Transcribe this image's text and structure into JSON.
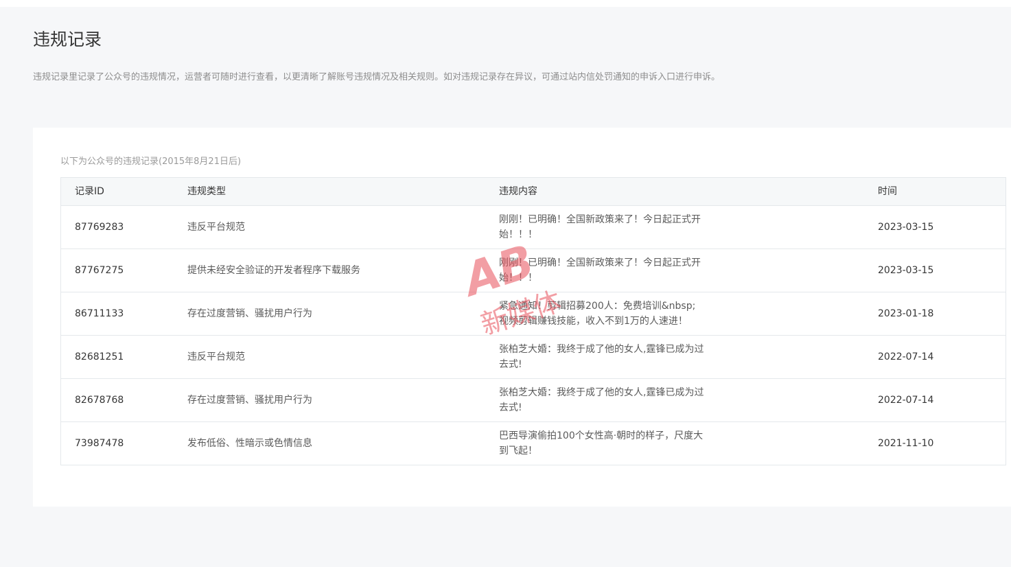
{
  "page": {
    "title": "违规记录",
    "description": "违规记录里记录了公众号的违规情况，运营者可随时进行查看，以更清晰了解账号违规情况及相关规则。如对违规记录存在异议，可通过站内信处罚通知的申诉入口进行申诉。"
  },
  "table": {
    "caption": "以下为公众号的违规记录(2015年8月21日后)",
    "headers": {
      "id": "记录ID",
      "type": "违规类型",
      "content": "违规内容",
      "time": "时间"
    },
    "rows": [
      {
        "id": "87769283",
        "type": "违反平台规范",
        "content": "刚刚！已明确！全国新政策来了！今日起正式开始！！！",
        "time": "2023-03-15"
      },
      {
        "id": "87767275",
        "type": "提供未经安全验证的开发者程序下载服务",
        "content": "刚刚！已明确！全国新政策来了！今日起正式开始！！！",
        "time": "2023-03-15"
      },
      {
        "id": "86711133",
        "type": "存在过度营销、骚扰用户行为",
        "content": "紧急通知！剪辑招募200人：免费培训&nbsp;视频剪辑赚钱技能，收入不到1万的人速进！",
        "time": "2023-01-18"
      },
      {
        "id": "82681251",
        "type": "违反平台规范",
        "content": "张柏芝大婚：我终于成了他的女人,霆锋已成为过去式!",
        "time": "2022-07-14"
      },
      {
        "id": "82678768",
        "type": "存在过度营销、骚扰用户行为",
        "content": "张柏芝大婚：我终于成了他的女人,霆锋已成为过去式!",
        "time": "2022-07-14"
      },
      {
        "id": "73987478",
        "type": "发布低俗、性暗示或色情信息",
        "content": "巴西导演偷拍100个女性高·朝时的样子，尺度大到飞起！",
        "time": "2021-11-10"
      }
    ]
  },
  "watermark": {
    "logo_text": "AB",
    "brand_text": "新媒体",
    "color": "#e8505b"
  }
}
